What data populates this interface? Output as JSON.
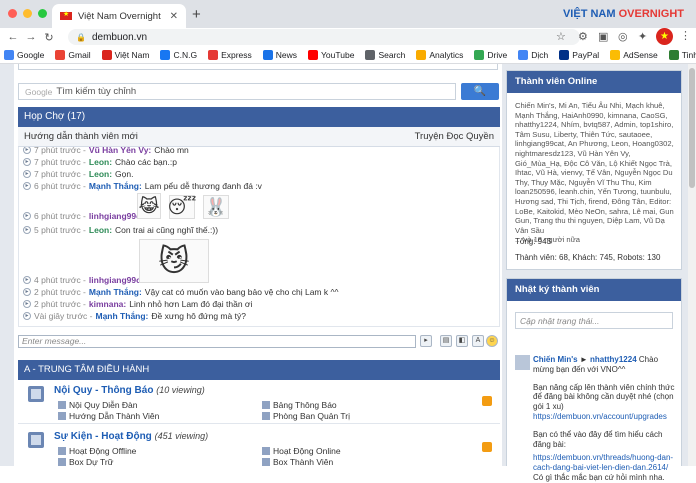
{
  "browser": {
    "tab_title": "Việt Nam Overnight",
    "tab_close": "✕",
    "new_tab": "+",
    "brand_blue": "VIỆT NAM",
    "brand_red": "OVERNIGHT",
    "url": "dembuon.vn",
    "bookmarks": [
      {
        "label": "Google",
        "color": "#4285f4"
      },
      {
        "label": "Gmail",
        "color": "#ea4335"
      },
      {
        "label": "Việt Nam",
        "color": "#da251d"
      },
      {
        "label": "C.N.G",
        "color": "#1877f2"
      },
      {
        "label": "Express",
        "color": "#e53935"
      },
      {
        "label": "News",
        "color": "#1a73e8"
      },
      {
        "label": "YouTube",
        "color": "#ff0000"
      },
      {
        "label": "Search",
        "color": "#5f6368"
      },
      {
        "label": "Analytics",
        "color": "#f9ab00"
      },
      {
        "label": "Drive",
        "color": "#34a853"
      },
      {
        "label": "Dịch",
        "color": "#4285f4"
      },
      {
        "label": "PayPal",
        "color": "#003087"
      },
      {
        "label": "AdSense",
        "color": "#fbbc04"
      },
      {
        "label": "Tinh Tế",
        "color": "#2e7d32"
      }
    ]
  },
  "search": {
    "brand": "Google",
    "placeholder": "Tìm kiếm tùy chỉnh",
    "button": "🔍"
  },
  "chatbox": {
    "title": "Họp Chợ (17)",
    "guide": "Hướng dẫn thành viên mới",
    "right_link": "Truyện Đọc Quyền",
    "messages": [
      {
        "time": "7 phút trước -",
        "nick": "Vũ Hàn Yên Vy:",
        "text": "Chào mn",
        "cls": "p"
      },
      {
        "time": "7 phút trước -",
        "nick": "Leon:",
        "text": "Chào các bạn.:p",
        "cls": "g"
      },
      {
        "time": "7 phút trước -",
        "nick": "Leon:",
        "text": "Gọn.",
        "cls": "g"
      },
      {
        "time": "6 phút trước -",
        "nick": "Mạnh Thắng:",
        "text": "Lam pểu dễ thương đanh đá :v",
        "cls": ""
      },
      {
        "time": "6 phút trước -",
        "nick": "linhgiang99cat:",
        "text": "",
        "cls": "p"
      },
      {
        "time": "5 phút trước -",
        "nick": "Leon:",
        "text": "Con trai ai cũng nghĩ thế.:))",
        "cls": "g"
      },
      {
        "time": "4 phút trước -",
        "nick": "linhgiang99cat:",
        "text": "",
        "cls": "p"
      },
      {
        "time": "2 phút trước -",
        "nick": "Mạnh Thắng:",
        "text": "Vậy cat có muốn vào bang bảo vệ cho chị Lam k ^^",
        "cls": ""
      },
      {
        "time": "2 phút trước -",
        "nick": "kimnana:",
        "text": "Linh nhỏ hơn Lam đó đại thần ơi",
        "cls": "p"
      },
      {
        "time": "Vài giây trước -",
        "nick": "Mạnh Thắng:",
        "text": "Đề xưng hô đứng mà tý?",
        "cls": ""
      }
    ],
    "input_placeholder": "Enter message..."
  },
  "section": {
    "title": "A - TRUNG TÂM ĐIỀU HÀNH",
    "forums": [
      {
        "title": "Nội Quy - Thông Báo",
        "viewing": "(10 viewing)",
        "subs": [
          "Nội Quy Diễn Đàn",
          "Bảng Thông Báo",
          "Hướng Dẫn Thành Viên",
          "Phòng Ban Quản Trị"
        ]
      },
      {
        "title": "Sự Kiện - Hoạt Động",
        "viewing": "(451 viewing)",
        "subs": [
          "Hoạt Động Offline",
          "Hoạt Động Online",
          "Box Dự Trữ",
          "Box Thành Viên"
        ]
      }
    ]
  },
  "online": {
    "title": "Thành viên Online",
    "members": "Chiến Min's, Mi An, Tiểu Âu Nhi, Mạch khuê, Mạnh Thắng, HaiAnh0990, kimnana, CaoSG, nhatthy1224, Nhím, bvtq587, Admin, top1shiro, Tâm Susu, Liberty, Thiên Tức, sautaoee, linhgiang99cat, An Phương, Leon, Hoang0302, nightmaresdz123, Vũ Hàn Yên Vy, Gió_Mùa_Hạ, Độc Cô Văn, Lộ Khiết Ngọc Trà, Ihtac, Vũ Hà, vienvy, Tế Vân, Nguyễn Ngọc Du Thy, Thụy Mặc, Nguyễn Vĩ Thu Thu, Kim loan250596, leanh.chin, Yến Tương, tuunbulu, Hương sad, Thi Tịch, firend, Đông Tân, Editor: LoBe, Kaitokid, Mèo NeOn, sahra, Lê mai, Gun Gun, Trang thu thi nguyen, Diệp Lam, Vũ Dạ Vân Sầu",
    "more": "... và 18 người nữa",
    "total": "Tổng: 943",
    "breakdown": "Thành viên: 68, Khách: 745, Robots: 130"
  },
  "diary": {
    "title": "Nhật ký thành viên",
    "placeholder": "Cập nhật trạng thái...",
    "author": "Chiến Min's",
    "arrow": "►",
    "target": "nhatthy1224",
    "greeting": "Chào mừng bạn đến với VNO^^",
    "body1": "Bạn nâng cấp lên thành viên chính thức để đăng bài không cần duyệt nhé (chọn gói 1 xu)",
    "link1": "https://dembuon.vn/account/upgrades",
    "body2": "Bạn có thể vào đây để tìm hiểu cách đăng bài:",
    "link2": "https://dembuon.vn/threads/huong-dan-cach-dang-bai-viet-len-dien-dan.2614/",
    "body3": "Có gì thắc mắc bạn cứ hỏi mình nha."
  },
  "colors": {
    "header": "#3c5f9e",
    "link": "#1e5db4",
    "accent_red": "#e53935"
  }
}
